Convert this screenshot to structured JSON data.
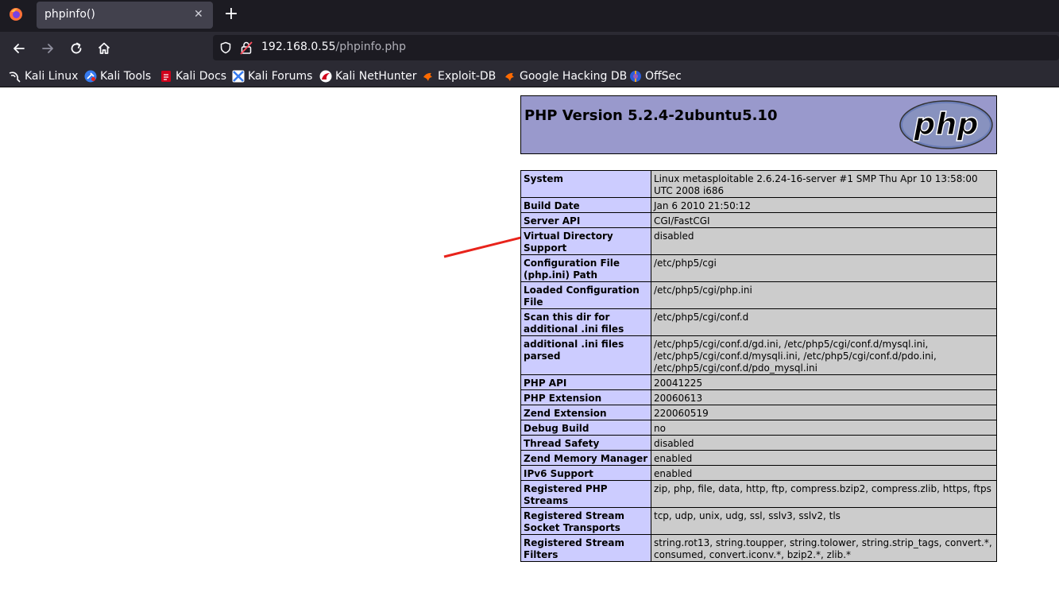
{
  "browser": {
    "tab": {
      "title": "phpinfo()",
      "close_icon": "close-icon"
    },
    "url": {
      "host": "192.168.0.55",
      "path": "/phpinfo.php"
    },
    "bookmarks": [
      {
        "label": "Kali Linux",
        "icon": "kali-dragon-icon"
      },
      {
        "label": "Kali Tools",
        "icon": "kali-tools-icon"
      },
      {
        "label": "Kali Docs",
        "icon": "kali-docs-icon"
      },
      {
        "label": "Kali Forums",
        "icon": "kali-forums-icon"
      },
      {
        "label": "Kali NetHunter",
        "icon": "nethunter-icon"
      },
      {
        "label": "Exploit-DB",
        "icon": "exploit-db-icon"
      },
      {
        "label": "Google Hacking DB",
        "icon": "ghdb-icon"
      },
      {
        "label": "OffSec",
        "icon": "offsec-icon"
      }
    ]
  },
  "php": {
    "version_title": "PHP Version 5.2.4-2ubuntu5.10",
    "logo_text": "php",
    "colors": {
      "header": "#9999cc",
      "key_cell": "#ccccff",
      "value_cell": "#cccccc",
      "annotation_arrow": "#e8231b"
    },
    "rows": [
      {
        "key": "System",
        "value": "Linux metasploitable 2.6.24-16-server #1 SMP Thu Apr 10 13:58:00 UTC 2008 i686"
      },
      {
        "key": "Build Date",
        "value": "Jan 6 2010 21:50:12"
      },
      {
        "key": "Server API",
        "value": "CGI/FastCGI"
      },
      {
        "key": "Virtual Directory Support",
        "value": "disabled"
      },
      {
        "key": "Configuration File (php.ini) Path",
        "value": "/etc/php5/cgi"
      },
      {
        "key": "Loaded Configuration File",
        "value": "/etc/php5/cgi/php.ini"
      },
      {
        "key": "Scan this dir for additional .ini files",
        "value": "/etc/php5/cgi/conf.d"
      },
      {
        "key": "additional .ini files parsed",
        "value": "/etc/php5/cgi/conf.d/gd.ini, /etc/php5/cgi/conf.d/mysql.ini, /etc/php5/cgi/conf.d/mysqli.ini, /etc/php5/cgi/conf.d/pdo.ini, /etc/php5/cgi/conf.d/pdo_mysql.ini"
      },
      {
        "key": "PHP API",
        "value": "20041225"
      },
      {
        "key": "PHP Extension",
        "value": "20060613"
      },
      {
        "key": "Zend Extension",
        "value": "220060519"
      },
      {
        "key": "Debug Build",
        "value": "no"
      },
      {
        "key": "Thread Safety",
        "value": "disabled"
      },
      {
        "key": "Zend Memory Manager",
        "value": "enabled"
      },
      {
        "key": "IPv6 Support",
        "value": "enabled"
      },
      {
        "key": "Registered PHP Streams",
        "value": "zip, php, file, data, http, ftp, compress.bzip2, compress.zlib, https, ftps"
      },
      {
        "key": "Registered Stream Socket Transports",
        "value": "tcp, udp, unix, udg, ssl, sslv3, sslv2, tls"
      },
      {
        "key": "Registered Stream Filters",
        "value": "string.rot13, string.toupper, string.tolower, string.strip_tags, convert.*, consumed, convert.iconv.*, bzip2.*, zlib.*"
      }
    ]
  }
}
